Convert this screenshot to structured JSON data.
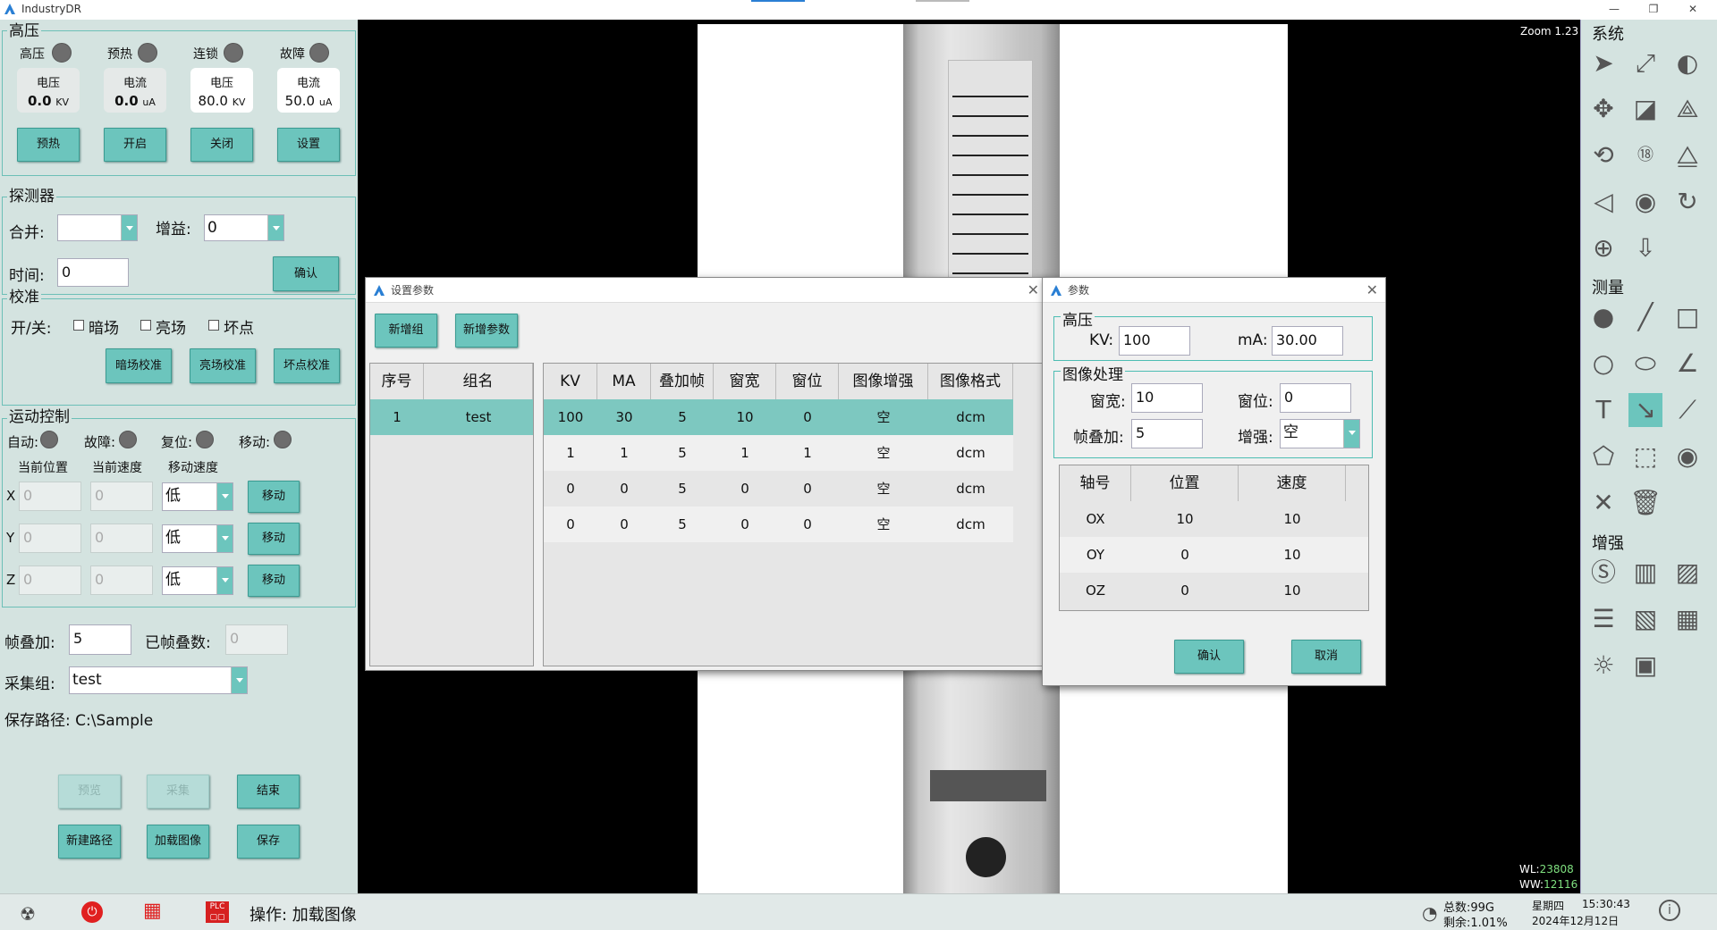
{
  "app": {
    "title": "IndustryDR"
  },
  "hv": {
    "title": "高压",
    "ind": [
      "高压",
      "预热",
      "连锁",
      "故障"
    ],
    "cards": [
      {
        "t": "电压",
        "v": "0.0",
        "u": "KV"
      },
      {
        "t": "电流",
        "v": "0.0",
        "u": "uA"
      },
      {
        "t": "电压",
        "v": "80.0",
        "u": "KV"
      },
      {
        "t": "电流",
        "v": "50.0",
        "u": "uA"
      }
    ],
    "btns": [
      "预热",
      "开启",
      "关闭",
      "设置"
    ]
  },
  "det": {
    "title": "探测器",
    "merge": "合并:",
    "gain": "增益:",
    "gain_val": "0",
    "time": "时间:",
    "time_val": "0",
    "confirm": "确认"
  },
  "cal": {
    "title": "校准",
    "switch": "开/关:",
    "dark": "暗场",
    "bright": "亮场",
    "bad": "坏点",
    "b1": "暗场校准",
    "b2": "亮场校准",
    "b3": "坏点校准"
  },
  "motion": {
    "title": "运动控制",
    "auto": "自动:",
    "fault": "故障:",
    "reset": "复位:",
    "move": "移动:",
    "h1": "当前位置",
    "h2": "当前速度",
    "h3": "移动速度",
    "axes": [
      {
        "n": "X",
        "p": "0",
        "s": "0",
        "sp": "低",
        "b": "移动"
      },
      {
        "n": "Y",
        "p": "0",
        "s": "0",
        "sp": "低",
        "b": "移动"
      },
      {
        "n": "Z",
        "p": "0",
        "s": "0",
        "sp": "低",
        "b": "移动"
      }
    ]
  },
  "acq": {
    "stack": "帧叠加:",
    "stack_val": "5",
    "stacked": "已帧叠数:",
    "stacked_val": "0",
    "group": "采集组:",
    "group_val": "test",
    "path": "保存路径:  C:\\Sample",
    "preview": "预览",
    "collect": "采集",
    "end": "结束",
    "newpath": "新建路径",
    "load": "加载图像",
    "save": "保存"
  },
  "viewer": {
    "zoom": "Zoom 1.23",
    "wl": "WL:",
    "wl_val": "23808",
    "ww": "WW:",
    "ww_val": "12116"
  },
  "right": {
    "s1": "系统",
    "s2": "测量",
    "s3": "增强"
  },
  "dlg1": {
    "title": "设置参数",
    "add_group": "新增组",
    "add_param": "新增参数",
    "gcols": [
      "序号",
      "组名"
    ],
    "groups": [
      [
        "1",
        "test"
      ]
    ],
    "pcols": [
      "KV",
      "MA",
      "叠加帧",
      "窗宽",
      "窗位",
      "图像增强",
      "图像格式"
    ],
    "params": [
      [
        "100",
        "30",
        "5",
        "10",
        "0",
        "空",
        "dcm"
      ],
      [
        "1",
        "1",
        "5",
        "1",
        "1",
        "空",
        "dcm"
      ],
      [
        "0",
        "0",
        "5",
        "0",
        "0",
        "空",
        "dcm"
      ],
      [
        "0",
        "0",
        "5",
        "0",
        "0",
        "空",
        "dcm"
      ]
    ]
  },
  "dlg2": {
    "title": "参数",
    "hv": "高压",
    "kv": "KV:",
    "kv_val": "100",
    "ma": "mA:",
    "ma_val": "30.00",
    "img": "图像处理",
    "ww": "窗宽:",
    "ww_val": "10",
    "wl": "窗位:",
    "wl_val": "0",
    "stack": "帧叠加:",
    "stack_val": "5",
    "enh": "增强:",
    "enh_val": "空",
    "cols": [
      "轴号",
      "位置",
      "速度"
    ],
    "rows": [
      [
        "OX",
        "10",
        "10"
      ],
      [
        "OY",
        "0",
        "10"
      ],
      [
        "OZ",
        "0",
        "10"
      ]
    ],
    "ok": "确认",
    "cancel": "取消"
  },
  "status": {
    "op": "操作:  加载图像",
    "total": "总数:99G",
    "remain": "剩余:1.01%",
    "day": "星期四",
    "time": "15:30:43",
    "date": "2024年12月12日"
  }
}
